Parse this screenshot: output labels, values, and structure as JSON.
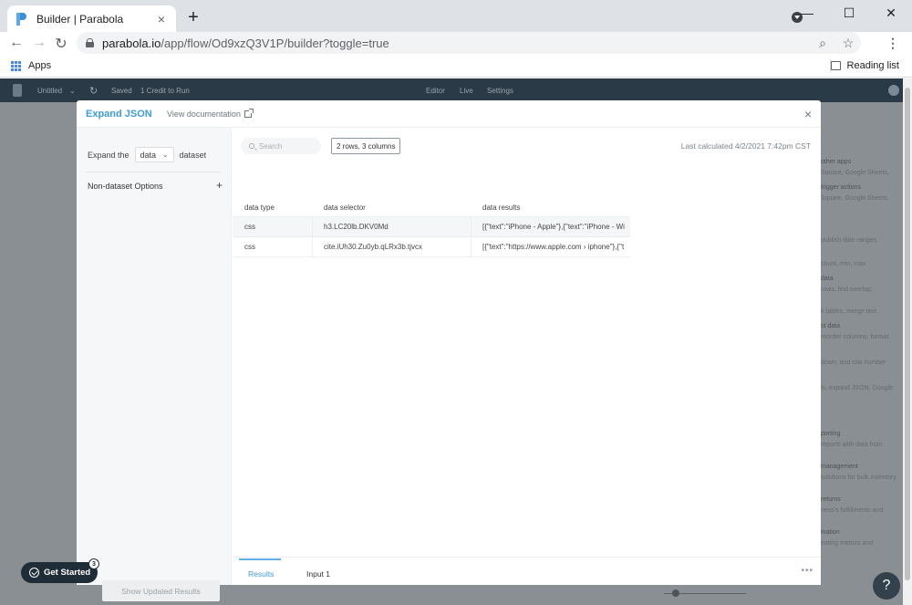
{
  "browser": {
    "tab_title": "Builder | Parabola",
    "tab_close": "×",
    "new_tab": "+",
    "url_host": "parabola.io",
    "url_path": "/app/flow/Od9xzQ3V1P/builder?toggle=true",
    "bookmark_apps": "Apps",
    "reading_list": "Reading list"
  },
  "app": {
    "flow_name": "Untitled",
    "saved_status": "Saved",
    "credit_text": "1 Credit to Run",
    "nav": [
      "Editor",
      "Live",
      "Settings"
    ],
    "side_items": [
      {
        "heading": "other apps",
        "text": "Square, Google Sheets,"
      },
      {
        "heading": "trigger actions",
        "text": "Square, Google Sheets,"
      },
      {
        "heading": "",
        "text": "publish date ranges"
      },
      {
        "heading": "",
        "text": "count, min, max"
      },
      {
        "heading": "data",
        "text": "rows, find overlap,"
      },
      {
        "heading": "",
        "text": "k tables, merge text"
      },
      {
        "heading": "st data",
        "text": "reorder columns, format"
      },
      {
        "heading": "",
        "text": "down, and row number"
      },
      {
        "heading": "",
        "text": "ls, expand JSON, Google"
      },
      {
        "heading": "porting",
        "text": "reports with data from"
      },
      {
        "heading": "management",
        "text": "solutions for bulk inventory"
      },
      {
        "heading": "returns",
        "text": "ness's fulfillments and"
      },
      {
        "heading": "ination",
        "text": "eating metrics and"
      }
    ]
  },
  "modal": {
    "title": "Expand JSON",
    "doc_link": "View documentation",
    "close": "×",
    "expand_prefix": "Expand the",
    "dataset_value": "data",
    "expand_suffix": "dataset",
    "non_dataset_options": "Non-dataset Options",
    "plus": "+",
    "show_updated_results": "Show Updated Results",
    "search_placeholder": "Search",
    "row_count": "2 rows, 3 columns",
    "last_calculated": "Last calculated 4/2/2021 7:42pm CST",
    "table": {
      "headers": [
        "data type",
        "data selector",
        "data results"
      ],
      "rows": [
        [
          "css",
          "h3.LC20lb.DKV0Md",
          "[{\"text\":\"iPhone - Apple\"},{\"text\":\"iPhone - Wi"
        ],
        [
          "css",
          "cite.iUh30.Zu0yb.qLRx3b.tjvcx",
          "[{\"text\":\"https://www.apple.com › iphone\"},{\"t"
        ]
      ]
    },
    "footer_tabs": [
      "Results",
      "Input 1"
    ],
    "more": "•••"
  },
  "get_started": {
    "label": "Get Started",
    "badge": "3"
  },
  "help": "?"
}
